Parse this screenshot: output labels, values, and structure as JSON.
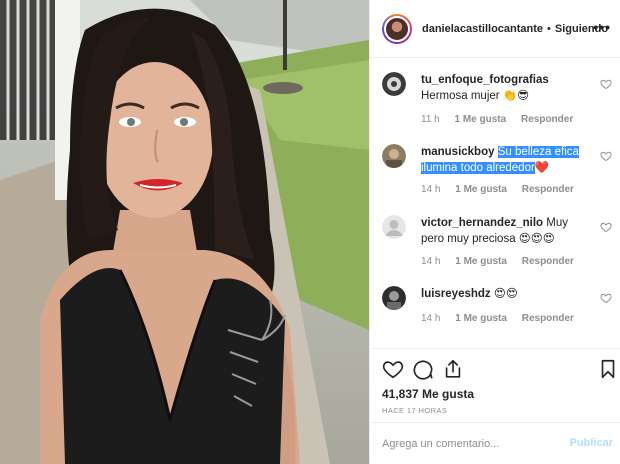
{
  "post": {
    "author": "danielacastillocantante",
    "separator": "•",
    "follow_state": "Siguiendo",
    "more_label": "•••"
  },
  "comments": [
    {
      "user": "tu_enfoque_fotografias",
      "text": "Hermosa mujer 👏😎",
      "time": "11 h",
      "likes": "1 Me gusta",
      "reply": "Responder"
    },
    {
      "user": "manusickboy",
      "text_selected": "Su belleza efica ilumina todo alrededor",
      "text_tail": "❤️",
      "time": "14 h",
      "likes": "1 Me gusta",
      "reply": "Responder"
    },
    {
      "user": "victor_hernandez_nilo",
      "text": "Muy pero muy preciosa 😍😍😍",
      "time": "14 h",
      "likes": "1 Me gusta",
      "reply": "Responder"
    },
    {
      "user": "luisreyeshdz",
      "text": "😍😍",
      "time": "14 h",
      "likes": "1 Me gusta",
      "reply": "Responder"
    }
  ],
  "stats": {
    "likes": "41,837 Me gusta",
    "time_ago": "HACE 17 HORAS"
  },
  "add_comment": {
    "placeholder": "Agrega un comentario...",
    "post_label": "Publicar"
  },
  "icons": {
    "like": "heart-icon",
    "comment": "comment-icon",
    "share": "share-icon",
    "save": "bookmark-icon",
    "more": "more-options-icon"
  },
  "colors": {
    "selection": "#3390ff",
    "text": "#262626",
    "muted": "#8e8e8e",
    "post_disabled": "#b2dffc"
  }
}
